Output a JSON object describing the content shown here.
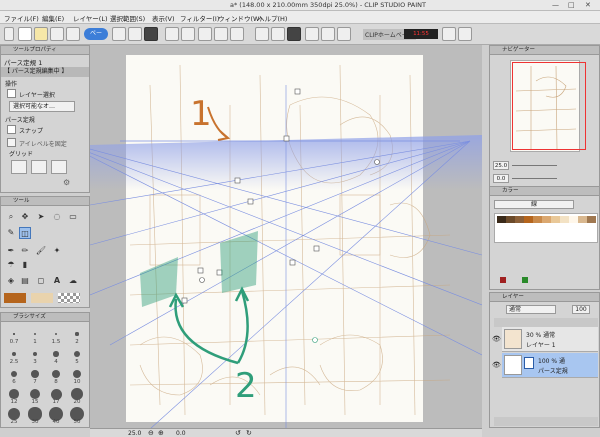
{
  "window": {
    "title": "a* (148.00 x 210.00mm 350dpi 25.0%) - CLIP STUDIO PAINT",
    "controls": [
      "—",
      "□",
      "✕"
    ]
  },
  "menu": [
    "ファイル(F)",
    "編集(E)",
    "レイヤー(L)",
    "選択範囲(S)",
    "表示(V)",
    "フィルター(I)",
    "ウィンドウ(W)",
    "ヘルプ(H)"
  ],
  "toolbar": {
    "beta_label": "ベー",
    "home_link": "CLIPホームページ",
    "rec_label": "11:55"
  },
  "tool_property": {
    "tab": "ツールプロパティ",
    "tool_name": "パース定規 1",
    "mode_banner": "【 パース定規編集中 】",
    "section_operation": "操作",
    "layer_select_label": "レイヤー選択",
    "selectable_label": "選択可能なオ…",
    "section_perspective": "パース定規",
    "snap_label": "スナップ",
    "eye_level_label": "アイレベルを固定",
    "grid_label": "グリッド"
  },
  "tool_panel": {
    "tab": "ツール"
  },
  "brush_size": {
    "tab": "ブラシサイズ",
    "sizes": [
      "0.7",
      "1",
      "1.5",
      "2",
      "2.5",
      "3",
      "4",
      "5",
      "6",
      "7",
      "8",
      "10",
      "12",
      "15",
      "17",
      "20",
      "25",
      "30",
      "40",
      "50"
    ]
  },
  "colors": {
    "main": "#b5651d",
    "sub": "#e9d3ad",
    "green_marker": "#2f9e7a",
    "orange_marker": "#c8732e",
    "perspective_blue": "#7b8fe0",
    "sketch": "#c49a6c",
    "page_bg": "#fbfaf5"
  },
  "canvas": {
    "annotation_1": "1",
    "annotation_2": "2"
  },
  "statusbar": {
    "zoom": "25.0",
    "angle": "0.0"
  },
  "navigator": {
    "tab": "ナビゲーター",
    "zoom": "25.0",
    "angle": "0.0"
  },
  "color_panel": {
    "tab": "カラー",
    "set_name": "線"
  },
  "layers": {
    "tab": "レイヤー",
    "blend_mode": "通常",
    "opacity": "100",
    "rows": [
      {
        "opacity_mode": "30 % 通常",
        "name": "レイヤー 1"
      },
      {
        "opacity_mode": "100 % 通",
        "name": "パース定規"
      }
    ]
  }
}
